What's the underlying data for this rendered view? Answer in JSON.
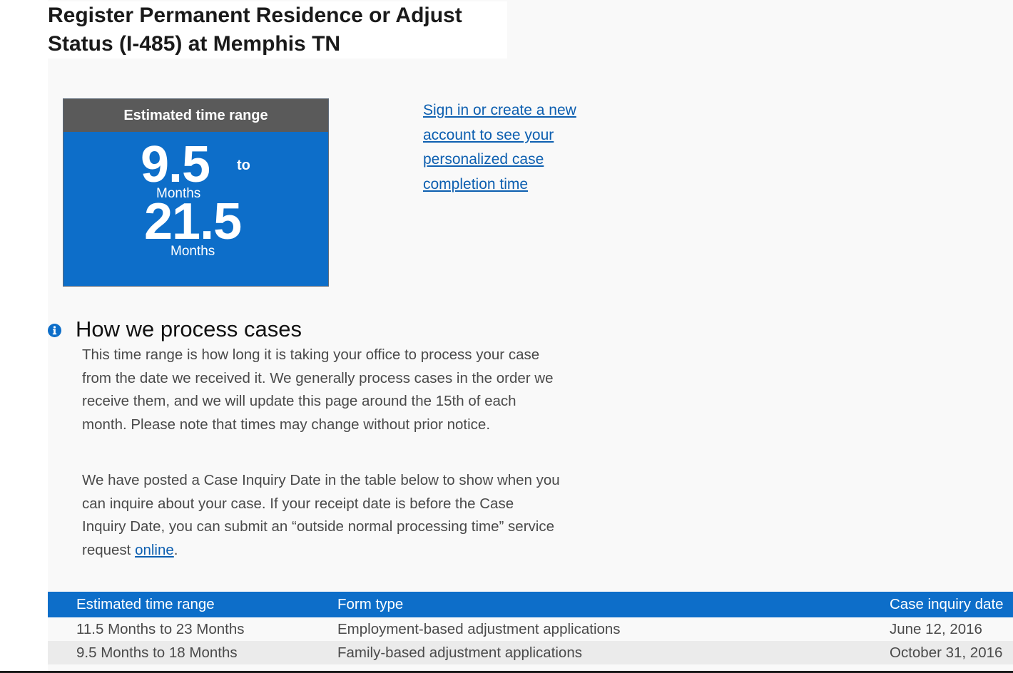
{
  "page": {
    "title": "Register Permanent Residence or Adjust Status (I-485) at Memphis TN"
  },
  "estimate": {
    "header": "Estimated time range",
    "min_value": "9.5",
    "min_unit": "Months",
    "connector": "to",
    "max_value": "21.5",
    "max_unit": "Months"
  },
  "signin": {
    "link_text": "Sign in or create a new account to see your personalized case completion time"
  },
  "process": {
    "title": "How we process cases",
    "paragraph1": "This time range is how long it is taking your office to process your case from the date we received it. We generally process cases in the order we receive them, and we will update this page around the 15th of each month. Please note that times may change without prior notice.",
    "paragraph2_text": "We have posted a Case Inquiry Date in the table below to show when you can inquire about your case. If your receipt date is before the Case Inquiry Date, you can submit an “outside normal processing time” service request ",
    "paragraph2_link": "online",
    "paragraph2_end": "."
  },
  "table": {
    "headers": [
      "Estimated time range",
      "Form type",
      "Case inquiry date"
    ],
    "rows": [
      [
        "11.5 Months to 23 Months",
        "Employment-based adjustment applications",
        "June 12, 2016"
      ],
      [
        "9.5 Months to 18 Months",
        "Family-based adjustment applications",
        "October 31, 2016"
      ]
    ]
  },
  "colors": {
    "accent_blue": "#0d6ec9",
    "header_gray": "#5a5a5a",
    "link_blue": "#0d5fb0"
  },
  "icons": {
    "info": "info-icon"
  }
}
